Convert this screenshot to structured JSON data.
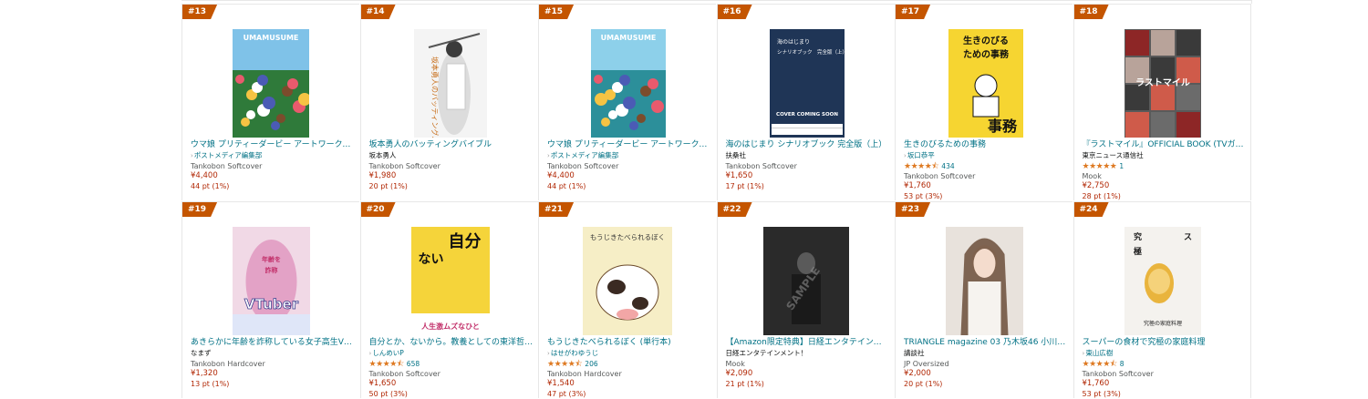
{
  "products": [
    {
      "rank": "#13",
      "title": "ウマ娘 プリティーダービー アートワークス…",
      "author": "ポストメディア編集部",
      "author_link": true,
      "format": "Tankobon Softcover",
      "price": "¥4,400",
      "points": "44 pt (1%)",
      "cover_text": "UMAMUSUME",
      "cover_colors": [
        "#2f7a3a",
        "#7fc2e8"
      ]
    },
    {
      "rank": "#14",
      "title": "坂本勇人のバッティングバイブル",
      "author": "坂本勇人",
      "author_link": false,
      "format": "Tankobon Softcover",
      "price": "¥1,980",
      "points": "20 pt (1%)",
      "cover_text": "坂本勇人のバッティングバイブル",
      "cover_colors": [
        "#f4f4f4",
        "#e8e8e8"
      ]
    },
    {
      "rank": "#15",
      "title": "ウマ娘 プリティーダービー アートワークス…",
      "author": "ポストメディア編集部",
      "author_link": true,
      "format": "Tankobon Softcover",
      "price": "¥4,400",
      "points": "44 pt (1%)",
      "cover_text": "UMAMUSUME",
      "cover_colors": [
        "#2c8f9a",
        "#8dd0ea"
      ]
    },
    {
      "rank": "#16",
      "title": "海のはじまり シナリオブック 完全版（上）",
      "author": "扶桑社",
      "author_link": false,
      "format": "Tankobon Softcover",
      "price": "¥1,650",
      "points": "17 pt (1%)",
      "cover_text": "COVER COMING SOON",
      "cover_subtext": "海のはじまり",
      "cover_subtext2": "シナリオブック　完全版（上）",
      "cover_colors": [
        "#1f3556",
        "#2b4468"
      ]
    },
    {
      "rank": "#17",
      "title": "生きのびるための事務",
      "author": "坂口恭平",
      "author_link": true,
      "rating_count": "434",
      "format": "Tankobon Softcover",
      "price": "¥1,760",
      "points": "53 pt (3%)",
      "cover_text": "生きのびるための事務",
      "cover_subtext": "事務",
      "cover_colors": [
        "#f6d531",
        "#ffffff"
      ]
    },
    {
      "rank": "#18",
      "title": "『ラストマイル』OFFICIAL BOOK (TVガイ…",
      "author": "東京ニュース通信社",
      "author_link": false,
      "rating_count": "1",
      "format": "Mook",
      "price": "¥2,750",
      "points": "28 pt (1%)",
      "cover_text": "ラストマイル",
      "cover_colors": [
        "#7a1e1e",
        "#3b3b3b"
      ]
    },
    {
      "rank": "#19",
      "title": "あきらかに年齢を詐称している女子高生VTuber",
      "author": "なまず",
      "author_link": false,
      "format": "Tankobon Hardcover",
      "price": "¥1,320",
      "points": "13 pt (1%)",
      "cover_text": "VTuber",
      "cover_subtext": "あきらかに年齢を詐称している",
      "cover_colors": [
        "#e6a6c8",
        "#9a6fa8"
      ]
    },
    {
      "rank": "#20",
      "title": "自分とか、ないから。教養としての東洋哲学…",
      "author": "しんめいP",
      "author_link": true,
      "rating_count": "658",
      "format": "Tankobon Softcover",
      "price": "¥1,650",
      "points": "50 pt (3%)",
      "cover_text": "自分とか、ないから。",
      "cover_subtext": "人生激ムズなひと",
      "cover_colors": [
        "#f5d43a",
        "#ffffff"
      ]
    },
    {
      "rank": "#21",
      "title": "もうじきたべられるぼく (単行本)",
      "author": "はせがわゆうじ",
      "author_link": true,
      "rating_count": "206",
      "format": "Tankobon Hardcover",
      "price": "¥1,540",
      "points": "47 pt (3%)",
      "cover_text": "もうじきたべられるぼく",
      "cover_colors": [
        "#f6eec6",
        "#e9dfae"
      ]
    },
    {
      "rank": "#22",
      "title": "【Amazon限定特典】日経エンタテインメン…",
      "author": "日経エンタテインメント！",
      "author_link": false,
      "format": "Mook",
      "price": "¥2,090",
      "points": "21 pt (1%)",
      "cover_text": "SAMPLE",
      "cover_colors": [
        "#2a2a2a",
        "#4a4a4a"
      ]
    },
    {
      "rank": "#23",
      "title": "TRIANGLE magazine 03 乃木坂46 小川彩…",
      "author": "講談社",
      "author_link": false,
      "format": "JP Oversized",
      "price": "¥2,000",
      "points": "20 pt (1%)",
      "cover_text": "",
      "cover_colors": [
        "#e8e2dc",
        "#c9b39c"
      ]
    },
    {
      "rank": "#24",
      "title": "スーパーの食材で究極の家庭料理",
      "author": "東山広樹",
      "author_link": true,
      "rating_count": "8",
      "format": "Tankobon Softcover",
      "price": "¥1,760",
      "points": "53 pt (3%)",
      "cover_text": "スーパーの食材で",
      "cover_subtext": "究極の家庭料理",
      "cover_colors": [
        "#f4f2ee",
        "#e0b245"
      ]
    }
  ],
  "ratings": {
    "#17": 4.5,
    "#18": 5,
    "#20": 4.5,
    "#21": 4.5,
    "#24": 4.5
  }
}
